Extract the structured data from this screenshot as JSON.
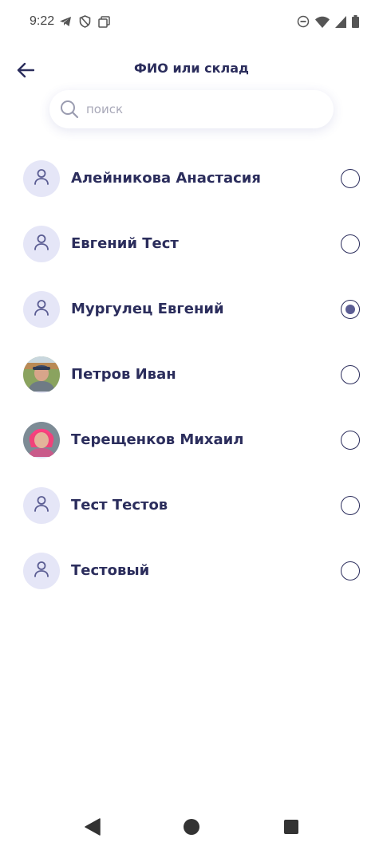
{
  "status_bar": {
    "time": "9:22",
    "left_icons": [
      "telegram-icon",
      "shield-icon",
      "copy-icon"
    ],
    "right_icons": [
      "do-not-disturb-icon",
      "wifi-icon",
      "signal-icon",
      "battery-icon"
    ]
  },
  "header": {
    "title": "ФИО или склад",
    "back_icon": "arrow-left-icon"
  },
  "search": {
    "placeholder": "поиск",
    "value": ""
  },
  "users": [
    {
      "name": "Алейникова Анастасия",
      "avatar": "person-icon",
      "selected": false
    },
    {
      "name": "Евгений Тест",
      "avatar": "person-icon",
      "selected": false
    },
    {
      "name": "Мургулец Евгений",
      "avatar": "person-icon",
      "selected": true
    },
    {
      "name": "Петров Иван",
      "avatar": "photo",
      "selected": false
    },
    {
      "name": "Терещенков Михаил",
      "avatar": "photo",
      "selected": false
    },
    {
      "name": "Тест Тестов",
      "avatar": "person-icon",
      "selected": false
    },
    {
      "name": "Тестовый",
      "avatar": "person-icon",
      "selected": false
    }
  ],
  "colors": {
    "primary_text": "#2b2d5c",
    "avatar_bg": "#e5e6f7",
    "radio_selected": "#5b5d93"
  },
  "nav_bar": [
    "back-triangle-icon",
    "home-circle-icon",
    "recents-square-icon"
  ]
}
